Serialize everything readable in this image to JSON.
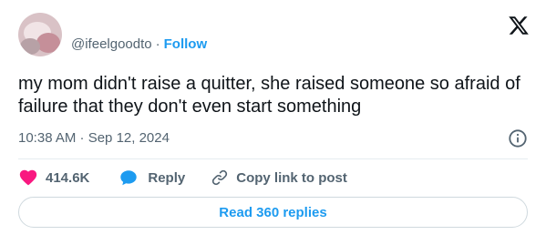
{
  "user": {
    "handle": "@ifeelgoodto",
    "separator": "·",
    "follow_label": "Follow"
  },
  "tweet": {
    "text": "my mom didn't raise a quitter, she raised someone so afraid of failure that they don't even start something",
    "timestamp": "10:38 AM · Sep 12, 2024"
  },
  "actions": {
    "like_count": "414.6K",
    "reply_label": "Reply",
    "copy_link_label": "Copy link to post"
  },
  "footer": {
    "read_replies_label": "Read 360 replies"
  },
  "icons": {
    "brand": "x-logo-icon",
    "info": "info-icon",
    "like": "heart-icon",
    "reply": "speech-bubble-icon",
    "copy": "link-icon"
  },
  "colors": {
    "accent": "#1d9bf0",
    "like": "#f91880",
    "text": "#0f1419",
    "muted": "#536471"
  }
}
